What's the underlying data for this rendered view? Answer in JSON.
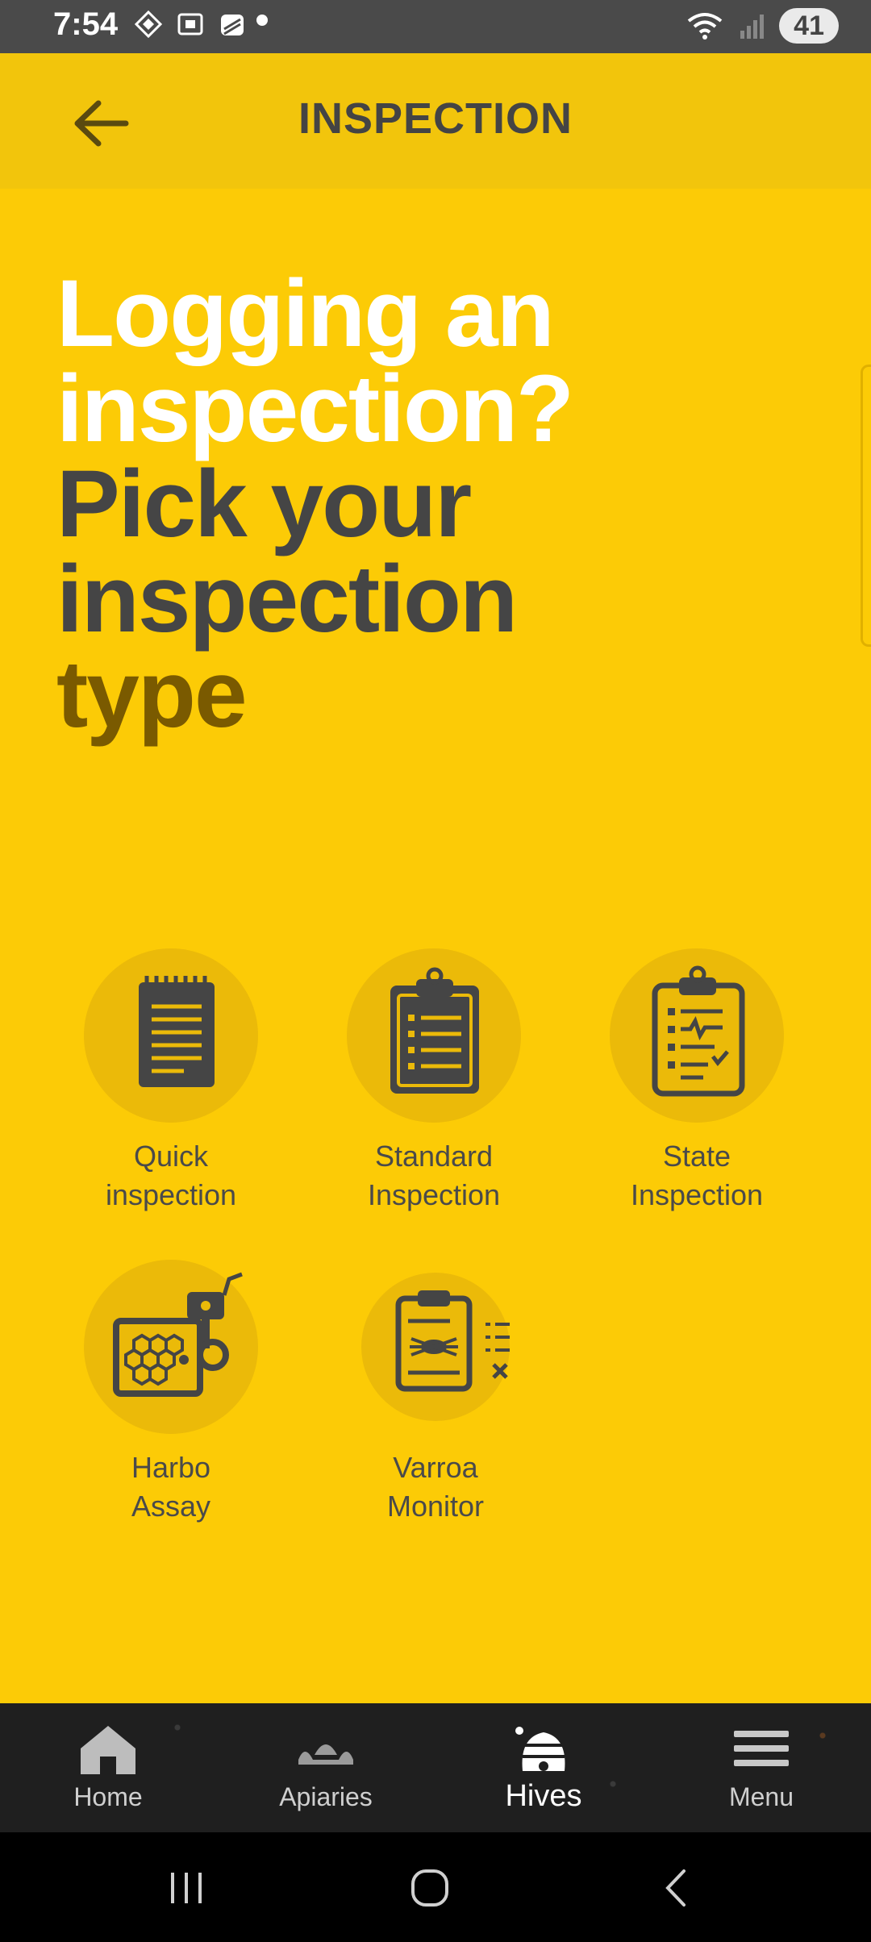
{
  "status_bar": {
    "time": "7:54",
    "battery": "41"
  },
  "header": {
    "title": "INSPECTION"
  },
  "headline": {
    "line1": "Logging an",
    "line2": "inspection?",
    "line3": "Pick your",
    "line4": "inspection",
    "line5": "type"
  },
  "options": [
    {
      "line1": "Quick",
      "line2": "inspection",
      "icon": "notepad-icon"
    },
    {
      "line1": "Standard",
      "line2": "Inspection",
      "icon": "clipboard-list-icon"
    },
    {
      "line1": "State",
      "line2": "Inspection",
      "icon": "clipboard-checklist-icon"
    },
    {
      "line1": "Harbo",
      "line2": "Assay",
      "icon": "honeycomb-frame-icon"
    },
    {
      "line1": "Varroa",
      "line2": "Monitor",
      "icon": "mite-clipboard-icon"
    }
  ],
  "bottom_nav": [
    {
      "label": "Home",
      "icon": "house-icon",
      "active": false
    },
    {
      "label": "Apiaries",
      "icon": "apiary-icon",
      "active": false
    },
    {
      "label": "Hives",
      "icon": "beehive-icon",
      "active": true
    },
    {
      "label": "Menu",
      "icon": "hamburger-icon",
      "active": false
    }
  ],
  "colors": {
    "background": "#FCCB06",
    "appbar": "#F2C50C",
    "icon_circle": "#EBBA09",
    "dark_text": "#454545",
    "accent_brown": "#7A5A00"
  }
}
